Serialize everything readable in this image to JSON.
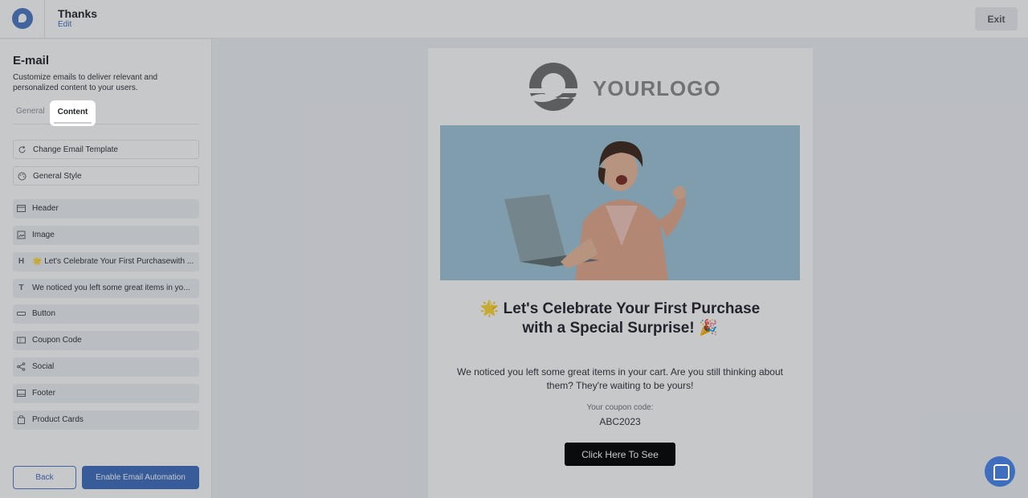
{
  "header": {
    "title": "Thanks",
    "edit_label": "Edit",
    "exit_label": "Exit"
  },
  "sidebar": {
    "title": "E-mail",
    "description": "Customize emails to deliver relevant and personalized content to your users.",
    "tabs": [
      {
        "label": "General",
        "active": false
      },
      {
        "label": "Content",
        "active": true
      }
    ],
    "settings": [
      {
        "label": "Change Email Template",
        "icon": "refresh-icon"
      },
      {
        "label": "General Style",
        "icon": "palette-icon"
      }
    ],
    "blocks": [
      {
        "label": "Header",
        "icon": "header-icon"
      },
      {
        "label": "Image",
        "icon": "image-icon"
      },
      {
        "label": "🌟 Let's Celebrate Your First Purchasewith ...",
        "icon": "heading-icon",
        "icon_glyph": "H"
      },
      {
        "label": "We noticed you left some great items in yo...",
        "icon": "text-icon",
        "icon_glyph": "T"
      },
      {
        "label": "Button",
        "icon": "button-icon"
      },
      {
        "label": "Coupon Code",
        "icon": "coupon-icon"
      },
      {
        "label": "Social",
        "icon": "share-icon"
      },
      {
        "label": "Footer",
        "icon": "footer-icon"
      },
      {
        "label": "Product Cards",
        "icon": "bag-icon"
      }
    ],
    "back_label": "Back",
    "enable_label": "Enable Email Automation"
  },
  "email": {
    "brand_text": "YOURLOGO",
    "headline_line1": "🌟 Let's Celebrate Your First Purchase",
    "headline_line2": "with a Special Surprise! 🎉",
    "body": "We noticed you left some great items in your cart. Are you still thinking about them? They're waiting to be yours!",
    "coupon_label": "Your coupon code:",
    "coupon_code": "ABC2023",
    "cta_label": "Click Here To See"
  },
  "colors": {
    "accent": "#3f6ebf",
    "hero_bg": "#9ec6d8",
    "cta_bg": "#000000"
  }
}
